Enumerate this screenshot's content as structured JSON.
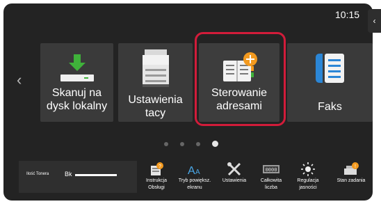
{
  "status": {
    "time": "10:15"
  },
  "colors": {
    "accent_red": "#d21c3a",
    "tile_bg": "#3a3a3a",
    "screen_bg": "#232323",
    "green": "#3fb23a",
    "orange": "#f39a1f",
    "blue": "#2b86d6"
  },
  "nav": {
    "prev_icon": "chevron-left-icon",
    "side_tab_icon": "chevron-left-icon"
  },
  "tiles": [
    {
      "label_line1": "Skanuj na",
      "label_line2": "dysk lokalny",
      "icon": "scan-to-drive-icon"
    },
    {
      "label_line1": "Ustawienia",
      "label_line2": "tacy",
      "icon": "printer-icon"
    },
    {
      "label_line1": "Sterowanie",
      "label_line2": "adresami",
      "icon": "address-book-add-icon",
      "selected": true
    },
    {
      "label_line1": "Faks",
      "label_line2": "",
      "icon": "fax-icon"
    }
  ],
  "pagination": {
    "pages": 4,
    "current": 4
  },
  "toner": {
    "label": "Ilość Tonera",
    "color_code": "Bk",
    "level": 1.0
  },
  "tools": [
    {
      "line1": "Instrukcja",
      "line2": "Obsługi",
      "icon": "manual-icon"
    },
    {
      "line1": "Tryb powiększ.",
      "line2": "ekranu",
      "icon": "text-zoom-icon"
    },
    {
      "line1": "Ustawienia",
      "line2": "",
      "icon": "settings-tools-icon"
    },
    {
      "line1": "Całkowita",
      "line2": "liczba",
      "icon": "counter-icon"
    },
    {
      "line1": "Regulacja",
      "line2": "jasności",
      "icon": "brightness-icon"
    },
    {
      "line1": "Stan zadania",
      "line2": "",
      "icon": "job-status-icon"
    }
  ]
}
